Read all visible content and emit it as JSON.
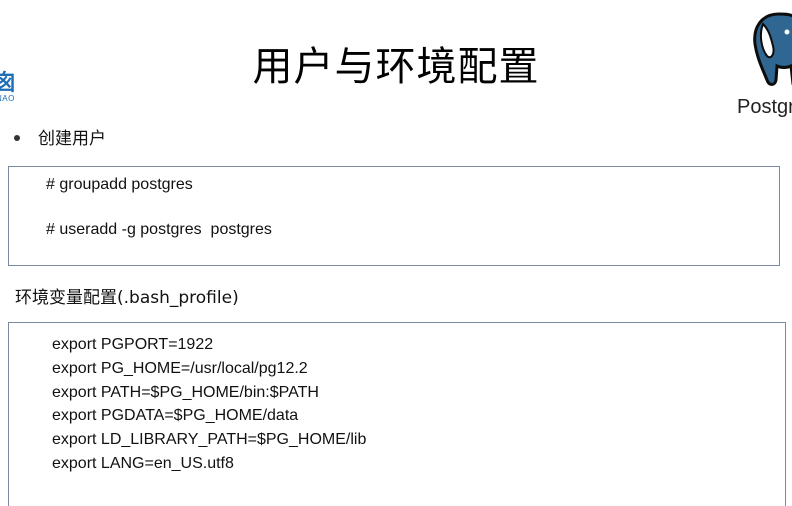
{
  "slide": {
    "title": "用户与环境配置",
    "left_logo": {
      "glyph": "囪",
      "sub": "NAO"
    },
    "logo": {
      "text": "Postgres",
      "icon": "elephant-icon",
      "color": "#2f6792"
    }
  },
  "section_user": {
    "bullet": "创建用户",
    "commands": [
      "# groupadd postgres",
      "# useradd -g postgres  postgres"
    ]
  },
  "section_env": {
    "title": "环境变量配置(.bash_profile)",
    "lines": [
      "export PGPORT=1922",
      "export PG_HOME=/usr/local/pg12.2",
      "export PATH=$PG_HOME/bin:$PATH",
      "export PGDATA=$PG_HOME/data",
      "export LD_LIBRARY_PATH=$PG_HOME/lib",
      "export LANG=en_US.utf8"
    ]
  }
}
